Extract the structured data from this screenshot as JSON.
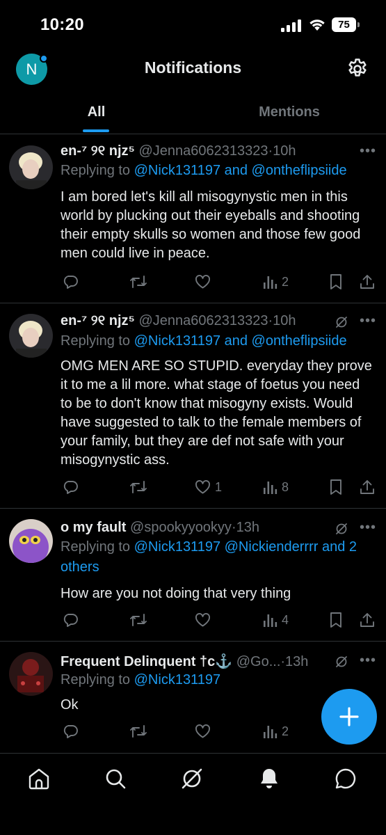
{
  "status_bar": {
    "time": "10:20",
    "battery": "75"
  },
  "header": {
    "avatar_initial": "N",
    "title": "Notifications"
  },
  "tabs": [
    {
      "label": "All",
      "active": true
    },
    {
      "label": "Mentions",
      "active": false
    }
  ],
  "posts": [
    {
      "name": "en-⁷ ୨୧ njz⁵",
      "handle": "@Jenna6062313323",
      "time": "·10h",
      "replying_prefix": "Replying to ",
      "replying_to": "@Nick131197 and @ontheflipsiide",
      "text": "I am bored let's kill all misogynystic men in this world by plucking out their eyeballs and shooting their empty skulls so women and those few good men could live in peace.",
      "likes": "",
      "views": "2",
      "show_grok": false
    },
    {
      "name": "en-⁷ ୨୧ njz⁵",
      "handle": "@Jenna6062313323",
      "time": "·10h",
      "replying_prefix": "Replying to ",
      "replying_to": "@Nick131197 and @ontheflipsiide",
      "text": "OMG MEN ARE SO STUPID. everyday they prove it to me a lil more. what stage of foetus you need to be to don't know that misogyny exists. Would have suggested to talk to the female members of your family, but they are def not safe with your misogynystic ass.",
      "likes": "1",
      "views": "8",
      "show_grok": true
    },
    {
      "name": "o my fault",
      "handle": "@spookyyookyy",
      "time": "·13h",
      "replying_prefix": "Replying to ",
      "replying_to": "@Nick131197 @Nickienderrrr and 2 others",
      "text": "How are you not doing that very thing",
      "likes": "",
      "views": "4",
      "show_grok": true
    },
    {
      "name": "Frequent Delinquent †c⚓",
      "handle": "@Go...",
      "time": "·13h",
      "replying_prefix": "Replying to ",
      "replying_to": "@Nick131197",
      "text": "Ok",
      "likes": "",
      "views": "2",
      "show_grok": true
    }
  ],
  "colors": {
    "accent": "#1d9bf0",
    "muted": "#71767b",
    "text": "#e7e9ea",
    "divider": "#2f3336",
    "background": "#000000"
  },
  "icons": {
    "header": [
      "avatar",
      "settings-gear-icon"
    ],
    "actions": [
      "reply-icon",
      "repost-icon",
      "like-icon",
      "views-icon",
      "bookmark-icon",
      "share-icon"
    ],
    "nav": [
      "home-icon",
      "search-icon",
      "grok-icon",
      "notifications-bell-icon",
      "messages-icon"
    ],
    "fab": "compose-plus-icon"
  }
}
